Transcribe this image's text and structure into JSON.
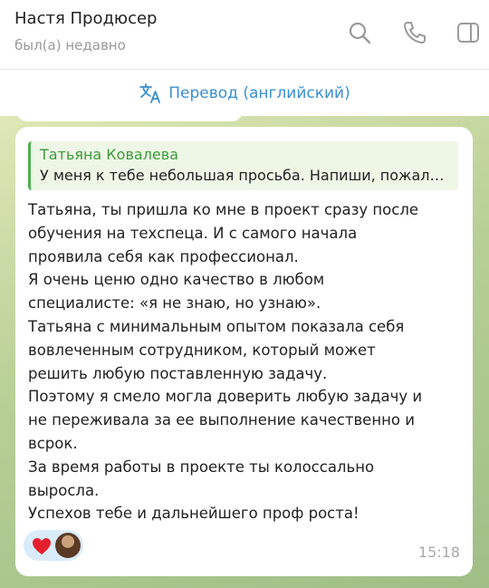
{
  "header": {
    "title": "Настя Продюсер",
    "status": "был(а) недавно"
  },
  "translate_bar": {
    "label": "Перевод (английский)"
  },
  "message": {
    "reply": {
      "name": "Татьяна Ковалева",
      "text": "У меня к тебе небольшая просьба. Напиши, пожалуйста, отзыв о работе"
    },
    "lines": [
      "Татьяна, ты пришла ко мне в проект сразу после",
      "обучения на техспеца. И с самого начала",
      "проявила себя как профессионал.",
      "Я очень ценю одно качество в любом",
      "специалисте: «я не знаю, но узнаю».",
      "Татьяна с минимальным опытом показала себя",
      "вовлеченным сотрудником, который может",
      "решить любую поставленную задачу.",
      "Поэтому я смело могла доверить любую задачу и",
      "не переживала за ее выполнение качественно и",
      "всрок.",
      "За время работы в проекте ты колоссально",
      "выросла.",
      "Успехов тебе и дальнейшего проф роста!"
    ],
    "time": "15:18",
    "reactions": {
      "emoji": "heart",
      "avatar": "reactor-avatar"
    }
  },
  "colors": {
    "accent": "#3a8fd1",
    "reply_name": "#3c9b3b",
    "reaction_bg": "#d9ecfb",
    "heart": "#e5202e"
  },
  "icons": [
    "search-icon",
    "phone-icon",
    "sidebar-panel-icon",
    "translate-icon"
  ]
}
